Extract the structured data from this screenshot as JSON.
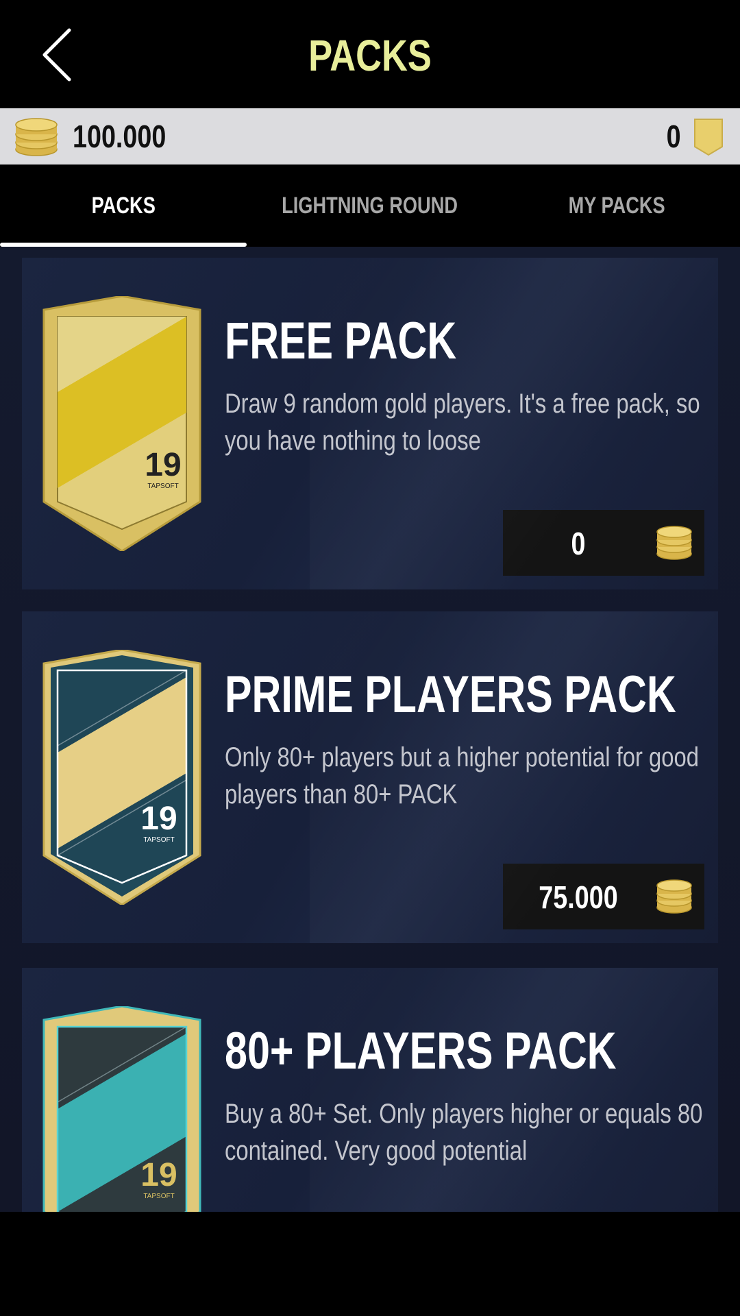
{
  "header": {
    "title": "PACKS"
  },
  "currency": {
    "coins": "100.000",
    "points": "0"
  },
  "tabs": [
    {
      "label": "PACKS",
      "active": true
    },
    {
      "label": "LIGHTNING ROUND",
      "active": false
    },
    {
      "label": "MY PACKS",
      "active": false
    }
  ],
  "packs": [
    {
      "title": "FREE PACK",
      "description": "Draw 9 random gold players. It's a free pack, so you have nothing to loose",
      "price": "0",
      "badge": "19",
      "brand": "TAPSOFT"
    },
    {
      "title": "PRIME PLAYERS PACK",
      "description": "Only 80+ players but a higher potential for good players than 80+ PACK",
      "price": "75.000",
      "badge": "19",
      "brand": "TAPSOFT"
    },
    {
      "title": "80+ PLAYERS PACK",
      "description": "Buy a 80+ Set. Only players higher or equals 80 contained. Very good potential",
      "badge": "19",
      "brand": "TAPSOFT"
    }
  ],
  "colors": {
    "title_accent": "#e8ee9a",
    "gold": "#d8c46a",
    "teal": "#3fb8b8",
    "card_bg": "#1a2340"
  }
}
